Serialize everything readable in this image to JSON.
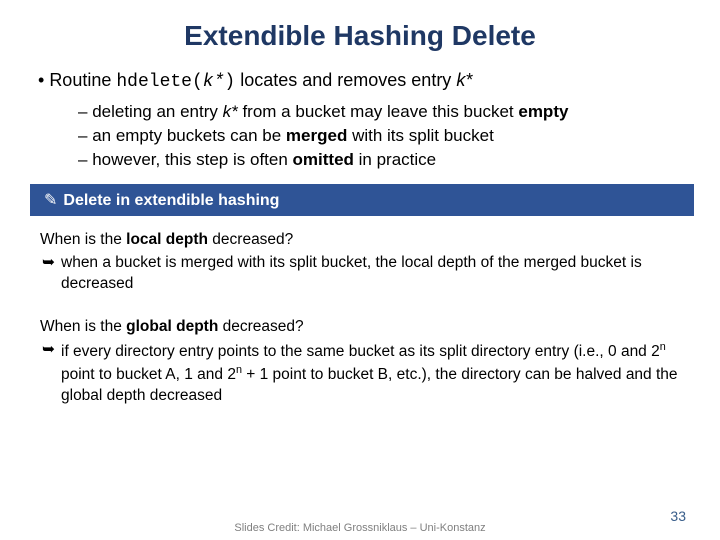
{
  "title": "Extendible Hashing Delete",
  "mainBullet": {
    "pre": "Routine ",
    "code": "hdelete(",
    "arg": "k*",
    "codeClose": ")",
    "post": " locates and removes entry ",
    "trail": "k*"
  },
  "subs": {
    "s1": {
      "a": "deleting an entry ",
      "b": "k*",
      "c": " from a bucket may leave this bucket ",
      "d": "empty"
    },
    "s2": {
      "a": "an empty buckets can be ",
      "b": "merged",
      "c": " with its split bucket"
    },
    "s3": {
      "a": "however, this step is often ",
      "b": "omitted",
      "c": " in practice"
    }
  },
  "banner": "Delete in extendible hashing",
  "q1": {
    "pre": "When is the ",
    "bold": "local depth",
    "post": " decreased?"
  },
  "a1": "when a bucket is merged with its split bucket, the local depth of the merged bucket is decreased",
  "q2": {
    "pre": "When is the ",
    "bold": "global depth",
    "post": " decreased?"
  },
  "a2": {
    "p1": "if every directory entry points to the same bucket as its split directory entry (i.e., 0 and 2",
    "sup1": "n",
    "p2": " point to bucket A, 1 and 2",
    "sup2": "n",
    "p3": " + 1 point to bucket B, etc.), the directory can be halved and the global depth decreased"
  },
  "credit": "Slides Credit: Michael Grossniklaus – Uni-Konstanz",
  "pageNum": "33"
}
